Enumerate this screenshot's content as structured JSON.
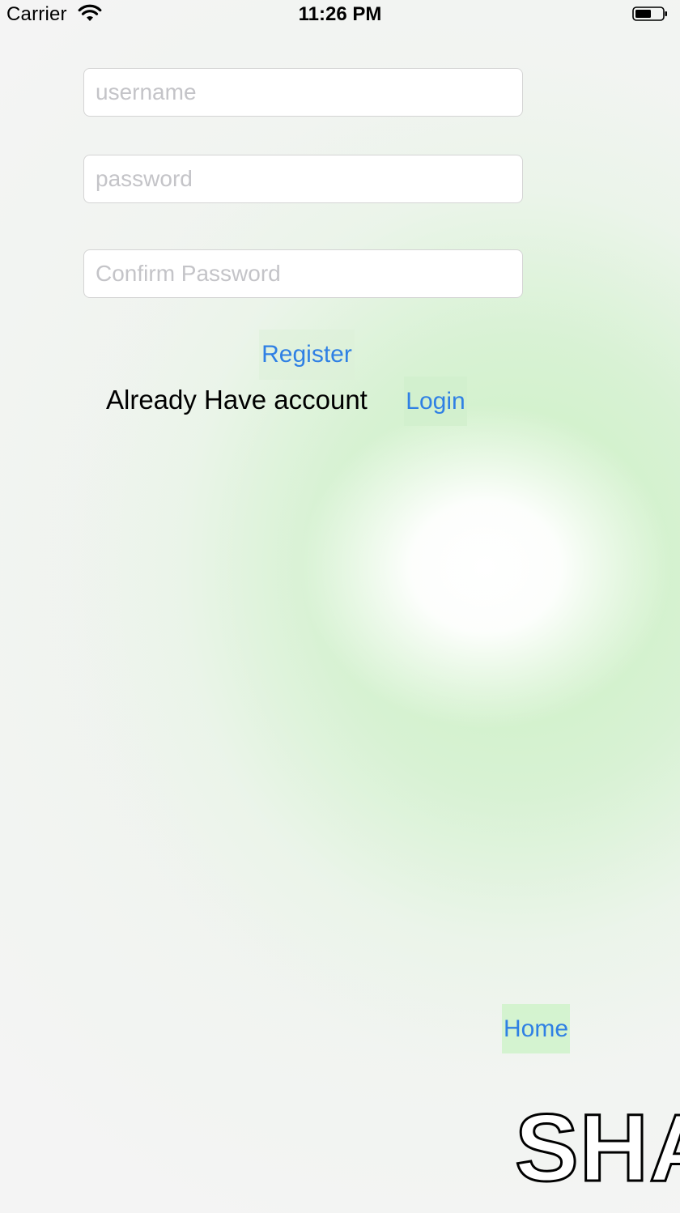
{
  "status_bar": {
    "carrier": "Carrier",
    "time": "11:26 PM"
  },
  "form": {
    "username_placeholder": "username",
    "username_value": "",
    "password_placeholder": "password",
    "password_value": "",
    "confirm_placeholder": "Confirm Password",
    "confirm_value": "",
    "register_label": "Register",
    "already_have_account": "Already Have account",
    "login_label": "Login"
  },
  "nav": {
    "home_label": "Home"
  },
  "watermark": {
    "text": "SHA"
  },
  "colors": {
    "link": "#2f80e4",
    "button_bg": "#d6f2d1",
    "background": "#f4f4f4",
    "placeholder": "#c4c4c8"
  },
  "icons": {
    "wifi": "wifi-icon",
    "battery": "battery-icon"
  }
}
